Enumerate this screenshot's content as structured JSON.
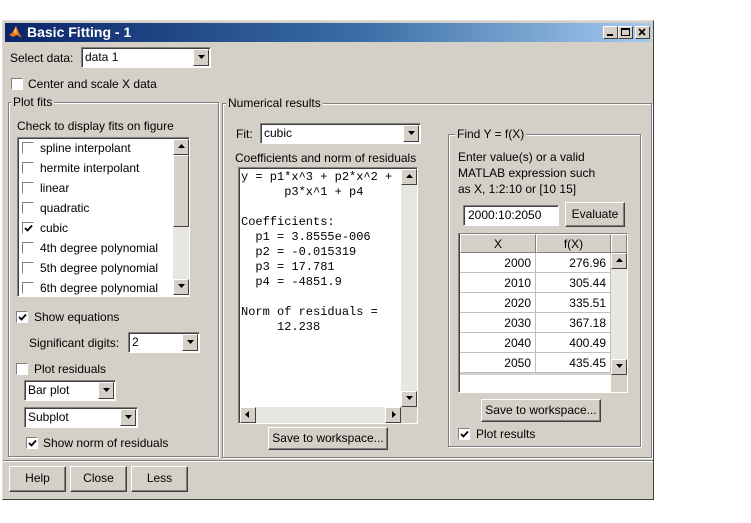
{
  "window": {
    "title": "Basic Fitting - 1",
    "title_icon": "matlab-logo-icon"
  },
  "select_data": {
    "label": "Select data:",
    "value": "data 1"
  },
  "center_scale": {
    "label": "Center and scale X data",
    "checked": false
  },
  "plot_fits": {
    "title": "Plot fits",
    "instruction": "Check to display fits on figure",
    "fits": [
      {
        "label": "spline interpolant",
        "checked": false
      },
      {
        "label": "hermite interpolant",
        "checked": false
      },
      {
        "label": "linear",
        "checked": false
      },
      {
        "label": "quadratic",
        "checked": false
      },
      {
        "label": "cubic",
        "checked": true
      },
      {
        "label": "4th degree polynomial",
        "checked": false
      },
      {
        "label": "5th degree polynomial",
        "checked": false
      },
      {
        "label": "6th degree polynomial",
        "checked": false
      }
    ],
    "show_equations": {
      "label": "Show equations",
      "checked": true
    },
    "sig_digits": {
      "label": "Significant digits:",
      "value": "2"
    },
    "plot_residuals": {
      "label": "Plot residuals",
      "checked": false
    },
    "plot_type": "Bar plot",
    "plot_location": "Subplot",
    "show_norm": {
      "label": "Show norm of residuals",
      "checked": true
    }
  },
  "numerical": {
    "title": "Numerical results",
    "fit_label": "Fit:",
    "fit_value": "cubic",
    "coeff_label": "Coefficients and norm of residuals",
    "results_text": "y = p1*x^3 + p2*x^2 +\n      p3*x^1 + p4\n\nCoefficients:\n  p1 = 3.8555e-006\n  p2 = -0.015319\n  p3 = 17.781\n  p4 = -4851.9\n\nNorm of residuals =\n     12.238",
    "save_button": "Save to workspace..."
  },
  "find_y": {
    "title": "Find Y = f(X)",
    "instructions": [
      "Enter value(s) or a valid",
      "MATLAB expression such",
      "as X, 1:2:10 or [10 15]"
    ],
    "input_value": "2000:10:2050",
    "evaluate_button": "Evaluate",
    "columns": [
      "X",
      "f(X)"
    ],
    "rows": [
      [
        "2000",
        "276.96"
      ],
      [
        "2010",
        "305.44"
      ],
      [
        "2020",
        "335.51"
      ],
      [
        "2030",
        "367.18"
      ],
      [
        "2040",
        "400.49"
      ],
      [
        "2050",
        "435.45"
      ]
    ],
    "save_button": "Save to workspace...",
    "plot_results": {
      "label": "Plot results",
      "checked": true
    }
  },
  "footer": {
    "help": "Help",
    "close": "Close",
    "less": "Less"
  }
}
